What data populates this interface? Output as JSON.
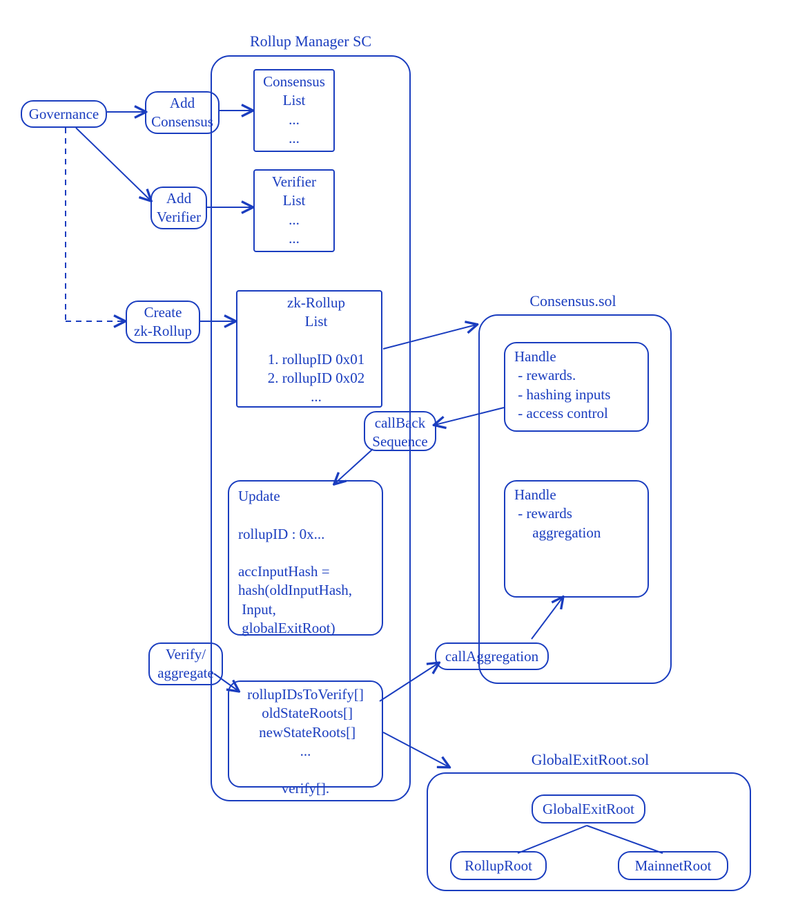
{
  "titles": {
    "rollupManager": "Rollup Manager SC",
    "consensus": "Consensus.sol",
    "globalExitRoot": "GlobalExitRoot.sol"
  },
  "nodes": {
    "governance": "Governance",
    "addConsensus": "Add\nConsensus",
    "addVerifier": "Add\nVerifier",
    "createZkRollup": "Create\nzk-Rollup",
    "consensusList": "Consensus\nList\n...\n...",
    "verifierList": "Verifier\nList\n...\n...",
    "zkRollupList": "zk-Rollup\nList\n\n1. rollupID 0x01\n2. rollupID 0x02\n...",
    "callbackSeq": "callBack\nSequence",
    "update": "Update\n\nrollupID : 0x...\n\naccInputHash =\nhash(oldInputHash,\n Input,\n globalExitRoot)",
    "verifyAgg": "Verify/\naggregate",
    "verifyBlock": "rollupIDsToVerify[]\n oldStateRoots[]\n newStateRoots[]\n...\n\nverify[].",
    "callAgg": "callAggregation",
    "handle1": "Handle\n - rewards.\n - hashing inputs\n - access control",
    "handle2": "Handle\n - rewards\n     aggregation",
    "ger": "GlobalExitRoot",
    "rollupRoot": "RollupRoot",
    "mainnetRoot": "MainnetRoot"
  }
}
